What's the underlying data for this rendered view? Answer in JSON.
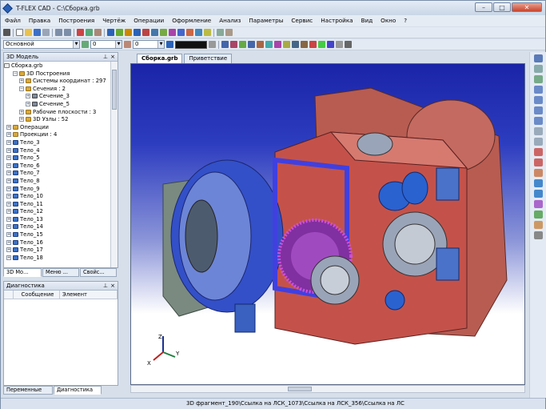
{
  "window": {
    "title": "T-FLEX CAD - C:\\Сборка.grb"
  },
  "menu": [
    "Файл",
    "Правка",
    "Построения",
    "Чертёж",
    "Операции",
    "Оформление",
    "Анализ",
    "Параметры",
    "Сервис",
    "Настройка",
    "Вид",
    "Окно",
    "?"
  ],
  "toolbar2": {
    "layer_combo": "Основной",
    "width_value": "0",
    "style_value": "0"
  },
  "model_panel": {
    "title": "3D Модель",
    "root": "Сборка.grb",
    "nodes": [
      {
        "label": "3D Построения",
        "level": 1,
        "exp": "−",
        "icon": "folder"
      },
      {
        "label": "Системы координат : 297",
        "level": 2,
        "exp": "+",
        "icon": "folder"
      },
      {
        "label": "Сечения : 2",
        "level": 2,
        "exp": "−",
        "icon": "folder"
      },
      {
        "label": "Сечение_3",
        "level": 3,
        "exp": "+",
        "icon": "sec"
      },
      {
        "label": "Сечение_5",
        "level": 3,
        "exp": "+",
        "icon": "sec"
      },
      {
        "label": "Рабочие плоскости : 3",
        "level": 2,
        "exp": "+",
        "icon": "folder"
      },
      {
        "label": "3D Узлы : 52",
        "level": 2,
        "exp": "+",
        "icon": "folder"
      },
      {
        "label": "Операции",
        "level": 0,
        "exp": "+",
        "icon": "folder"
      },
      {
        "label": "Проекции : 4",
        "level": 0,
        "exp": "+",
        "icon": "folder"
      },
      {
        "label": "Тело_3",
        "level": 0,
        "exp": "+",
        "icon": "body"
      },
      {
        "label": "Тело_4",
        "level": 0,
        "exp": "+",
        "icon": "body"
      },
      {
        "label": "Тело_5",
        "level": 0,
        "exp": "+",
        "icon": "body"
      },
      {
        "label": "Тело_6",
        "level": 0,
        "exp": "+",
        "icon": "body"
      },
      {
        "label": "Тело_7",
        "level": 0,
        "exp": "+",
        "icon": "body"
      },
      {
        "label": "Тело_8",
        "level": 0,
        "exp": "+",
        "icon": "body"
      },
      {
        "label": "Тело_9",
        "level": 0,
        "exp": "+",
        "icon": "body"
      },
      {
        "label": "Тело_10",
        "level": 0,
        "exp": "+",
        "icon": "body"
      },
      {
        "label": "Тело_11",
        "level": 0,
        "exp": "+",
        "icon": "body"
      },
      {
        "label": "Тело_12",
        "level": 0,
        "exp": "+",
        "icon": "body"
      },
      {
        "label": "Тело_13",
        "level": 0,
        "exp": "+",
        "icon": "body"
      },
      {
        "label": "Тело_14",
        "level": 0,
        "exp": "+",
        "icon": "body"
      },
      {
        "label": "Тело_15",
        "level": 0,
        "exp": "+",
        "icon": "body"
      },
      {
        "label": "Тело_16",
        "level": 0,
        "exp": "+",
        "icon": "body"
      },
      {
        "label": "Тело_17",
        "level": 0,
        "exp": "+",
        "icon": "body"
      },
      {
        "label": "Тело_18",
        "level": 0,
        "exp": "+",
        "icon": "body"
      }
    ],
    "tabs": [
      "3D Мо...",
      "Меню ...",
      "Свойс..."
    ]
  },
  "diag_panel": {
    "title": "Диагностика",
    "columns": [
      "Сообщение",
      "Элемент"
    ],
    "tabs": [
      "Переменные",
      "Диагностика"
    ]
  },
  "doc_tabs": [
    "Сборка.grb",
    "Приветствие"
  ],
  "axes": {
    "x": "X",
    "y": "Y",
    "z": "Z"
  },
  "status": {
    "text": "3D фрагмент_190\\Ссылка на ЛСК_1073\\Ссылка на ЛСК_356\\Ссылка на ЛС"
  },
  "colors": {
    "accent": "#2a62b8",
    "viewport_top": "#1a24a8",
    "body_red": "#c4524a",
    "body_blue": "#3350c8"
  }
}
